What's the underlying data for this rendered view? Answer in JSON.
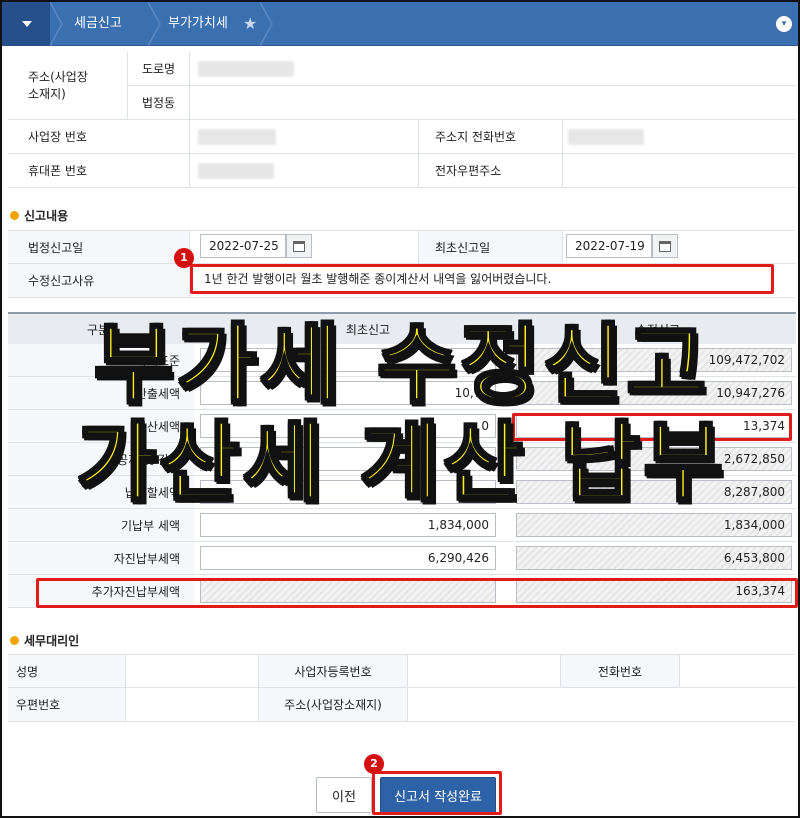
{
  "breadcrumb": {
    "level1": "세금신고",
    "level2": "부가가치세"
  },
  "business_info": {
    "address_label": "주소(사업장\n소재지)",
    "road_label": "도로명",
    "legal_dong_label": "법정동",
    "place_number_label": "사업장 번호",
    "address_phone_label": "주소지 전화번호",
    "mobile_label": "휴대폰 번호",
    "email_label": "전자우편주소"
  },
  "report": {
    "section_title": "신고내용",
    "legal_date_label": "법정신고일",
    "legal_date_value": "2022-07-25",
    "first_date_label": "최초신고일",
    "first_date_value": "2022-07-19",
    "reason_label": "수정신고사유",
    "reason_value": "1년 한건 발행이라 월초 발행해준 종이계산서 내역을 잃어버렸습니다."
  },
  "calc": {
    "header_col0": "구분",
    "header_col1": "최초신고",
    "header_col2": "수정신고",
    "rows": [
      {
        "label": "과세표준",
        "first": "7",
        "amended": "109,472,702"
      },
      {
        "label": "산출세액",
        "first": "10,79",
        "amended": "10,947,276"
      },
      {
        "label": "가산세액",
        "first": "0",
        "amended": "13,374"
      },
      {
        "label": "공제 및 감면",
        "first": "",
        "amended": "2,672,850"
      },
      {
        "label": "납부할세액",
        "first": "",
        "amended": "8,287,800"
      },
      {
        "label": "기납부 세액",
        "first": "1,834,000",
        "amended": "1,834,000"
      },
      {
        "label": "자진납부세액",
        "first": "6,290,426",
        "amended": "6,453,800"
      },
      {
        "label": "추가자진납부세액",
        "first": "",
        "amended": "163,374"
      }
    ]
  },
  "agent": {
    "section_title": "세무대리인",
    "name_label": "성명",
    "biz_reg_label": "사업자등록번호",
    "phone_label": "전화번호",
    "postal_label": "우편번호",
    "address_label": "주소(사업장소재지)"
  },
  "overlay": {
    "line1": "부가세 수정신고",
    "line2": "가산세 계산 납부"
  },
  "badges": {
    "one": "1",
    "two": "2"
  },
  "buttons": {
    "prev": "이전",
    "done": "신고서 작성완료"
  },
  "colors": {
    "accent_blue": "#3a6fb0",
    "highlight_red": "#e11a1a",
    "overlay_yellow": "#fff21a"
  }
}
